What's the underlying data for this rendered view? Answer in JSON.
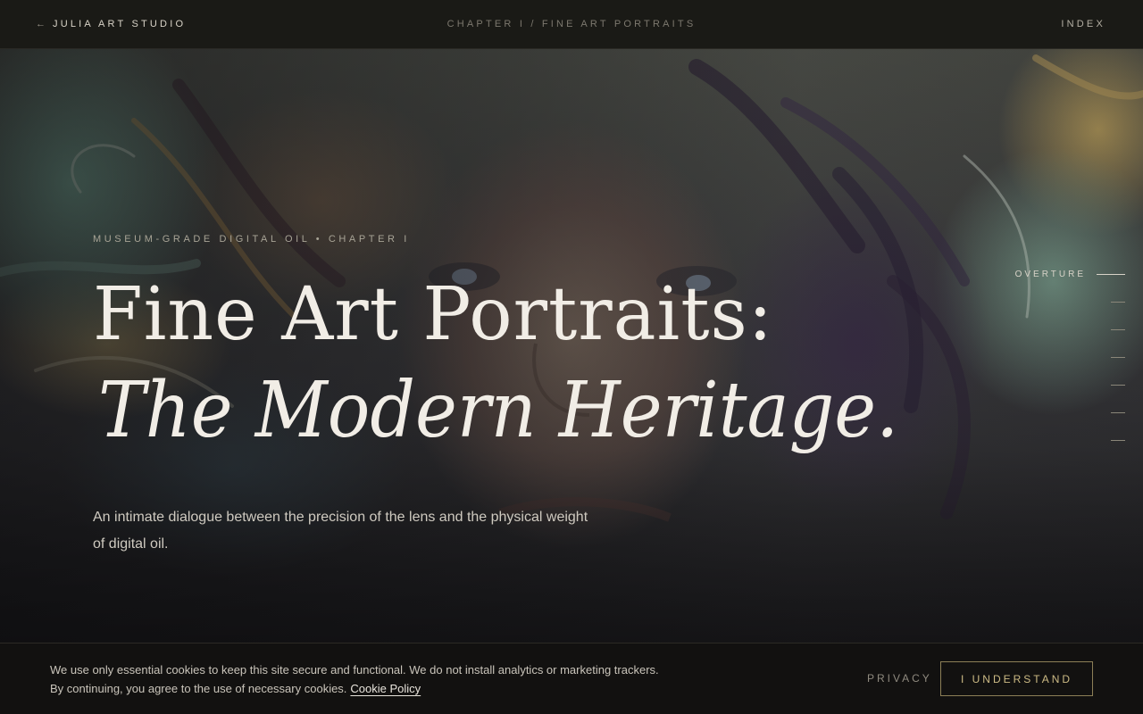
{
  "header": {
    "brand": "JULIA ART STUDIO",
    "back_icon": "arrow-left-icon",
    "chapter": "CHAPTER I / FINE ART PORTRAITS",
    "index": "INDEX"
  },
  "hero": {
    "background": "oil-portrait-painting",
    "eyebrow": "MUSEUM-GRADE DIGITAL OIL • CHAPTER I",
    "title_line1": "Fine Art Portraits:",
    "title_line2": "The Modern Heritage.",
    "lede": "An intimate dialogue between the precision of the lens and the physical weight of digital oil."
  },
  "side_nav": {
    "active_label": "OVERTURE",
    "items": [
      "overture",
      "section-2",
      "section-3",
      "section-4",
      "section-5",
      "section-6"
    ]
  },
  "cookie_banner": {
    "text": "We use only essential cookies to keep this site secure and functional. We do not install analytics or marketing trackers. By continuing, you agree to the use of necessary cookies.",
    "link": "Cookie Policy",
    "privacy": "PRIVACY",
    "accept": "I UNDERSTAND"
  },
  "colors": {
    "bar_bg": "#1a1a16",
    "accent_gold": "#cdbb85",
    "text_light": "#f1ede6"
  }
}
